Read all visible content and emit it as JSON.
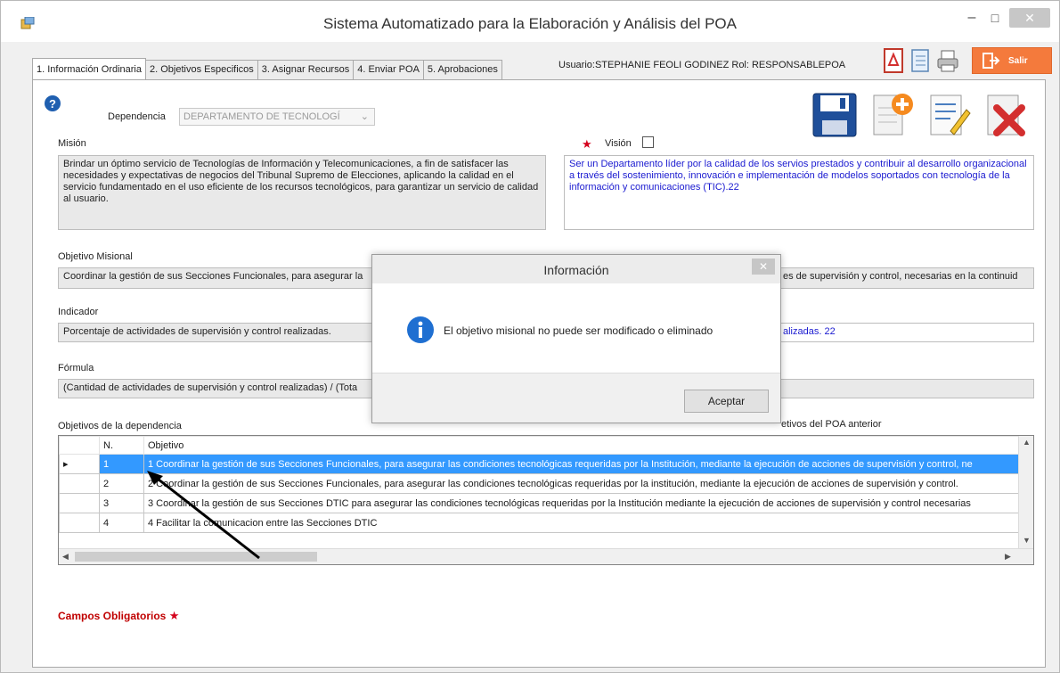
{
  "window": {
    "title": "Sistema Automatizado para la Elaboración y Análisis del POA",
    "minimize": "–",
    "maximize": "□",
    "close": "✕"
  },
  "tabs": [
    {
      "label": "1. Información Ordinaria",
      "active": true
    },
    {
      "label": "2. Objetivos Especificos",
      "active": false
    },
    {
      "label": "3. Asignar Recursos",
      "active": false
    },
    {
      "label": "4. Enviar POA",
      "active": false
    },
    {
      "label": "5. Aprobaciones",
      "active": false
    }
  ],
  "user": {
    "text": "Usuario:STEPHANIE FEOLI GODINEZ  Rol: RESPONSABLEPOA"
  },
  "salir": {
    "label": "Salir"
  },
  "form": {
    "dependencia_label": "Dependencia",
    "dependencia_value": "DEPARTAMENTO DE TECNOLOGÍ",
    "mision_label": "Misión",
    "mision_text": "Brindar un óptimo servicio de Tecnologías de Información y Telecomunicaciones, a fin de satisfacer las necesidades y expectativas de negocios del Tribunal Supremo de Elecciones, aplicando la calidad en el servicio fundamentado en el uso eficiente de los recursos tecnológicos, para garantizar un servicio de calidad al usuario.",
    "vision_label": "Visión",
    "vision_text": "Ser un Departamento líder por la calidad de los servios prestados y contribuir al desarrollo organizacional a través del sostenimiento, innovación e implementación de modelos soportados con tecnología de la información y comunicaciones (TIC).22",
    "objetivo_misional_label": "Objetivo Misional",
    "objetivo_misional_left": "Coordinar la gestión de sus Secciones Funcionales, para asegurar la",
    "objetivo_misional_right": "es de supervisión y control, necesarias en la continuid",
    "indicador_label": "Indicador",
    "indicador_left": "Porcentaje de actividades de supervisión y control realizadas.",
    "indicador_right": "alizadas. 22",
    "formula_label": "Fórmula",
    "formula_left": "(Cantidad de actividades de supervisión y control realizadas) / (Tota",
    "objetivos_dep_label": "Objetivos de la dependencia",
    "objetivos_ant_label": "etivos del POA anterior",
    "required_note": "Campos Obligatorios",
    "required_star": "★"
  },
  "grid": {
    "columns": [
      "N.",
      "Objetivo"
    ],
    "rows": [
      {
        "n": "1",
        "objetivo": "1 Coordinar la gestión de sus Secciones Funcionales, para asegurar las condiciones tecnológicas requeridas por la Institución, mediante la ejecución de acciones de supervisión y control, ne",
        "selected": true
      },
      {
        "n": "2",
        "objetivo": "2 Coordinar la gestión de sus Secciones Funcionales, para asegurar las condiciones tecnológicas requeridas por la institución, mediante la ejecución de acciones de supervisión y control.",
        "selected": false
      },
      {
        "n": "3",
        "objetivo": "3 Coordinar la gestión de sus Secciones DTIC para asegurar las condiciones tecnológicas requeridas por la Institución mediante la ejecución de acciones de supervisión y control necesarias",
        "selected": false
      },
      {
        "n": "4",
        "objetivo": "4 Facilitar la comunicacion entre las Secciones DTIC",
        "selected": false
      }
    ],
    "row_indicator": "▸"
  },
  "dialog": {
    "title": "Información",
    "message": "El objetivo misional no puede ser modificado o eliminado",
    "button": "Aceptar",
    "close": "✕"
  },
  "colors": {
    "accent": "#3399ff",
    "salir": "#f47a3c",
    "required": "#c00000",
    "link_text": "#1a1ad0"
  }
}
